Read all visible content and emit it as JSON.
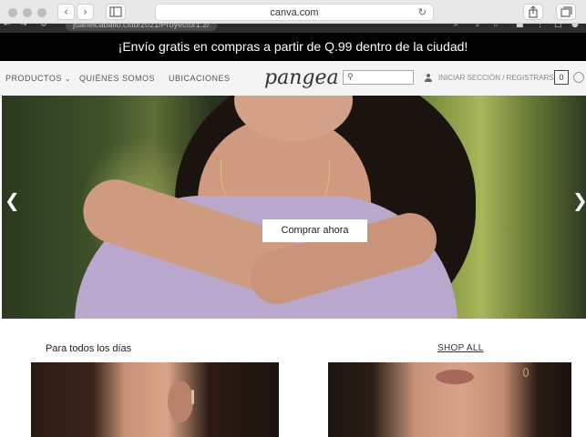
{
  "browser": {
    "url": "canva.com",
    "inner_url": "juaneicaballo.club/2021/Proyecto/1.2/"
  },
  "promo": {
    "text": "¡Envío gratis en compras a partir de Q.99 dentro de la ciudad!"
  },
  "nav": {
    "products": "PRODUCTOS",
    "about": "QUIÉNES SOMOS",
    "locations": "UBICACIONES",
    "logo": "pangea",
    "search_placeholder": "",
    "login": "INICIAR SECCIÓN / REGISTRARSE",
    "cart_count": "0"
  },
  "hero": {
    "cta": "Comprar ahora"
  },
  "section": {
    "title": "Para todos los días",
    "shop_all": "SHOP ALL"
  },
  "icons": {
    "prev": "chevron-left-icon",
    "next": "chevron-right-icon",
    "search": "search-icon",
    "user": "user-icon",
    "reload": "reload-icon"
  }
}
